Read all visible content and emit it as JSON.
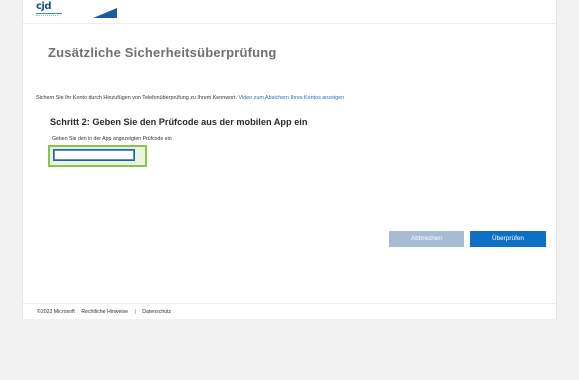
{
  "header": {
    "logo_text": "cjd",
    "logo_sub": "Christliches Jugenddorfwerk"
  },
  "page": {
    "title": "Zusätzliche Sicherheitsüberprüfung",
    "intro_text": "Sichern Sie Ihr Konto durch Hinzufügen von Telefonüberprüfung zu Ihrem Kennwort.",
    "intro_link": "Video zum Absichern Ihres Kontos anzeigen"
  },
  "step": {
    "title": "Schritt 2: Geben Sie den Prüfcode aus der mobilen App ein",
    "code_label": "Geben Sie den in der App angezeigten Prüfcode ein",
    "code_value": ""
  },
  "buttons": {
    "cancel": "Abbrechen",
    "verify": "Überprüfen"
  },
  "footer": {
    "copyright": "©2022 Microsoft",
    "legal": "Rechtliche Hinweise",
    "separator": "|",
    "privacy": "Datenschutz"
  },
  "colors": {
    "primary": "#0f6fc6",
    "disabled": "#a7bcd4",
    "highlight": "#8bc34a",
    "link": "#2a6fb5"
  }
}
